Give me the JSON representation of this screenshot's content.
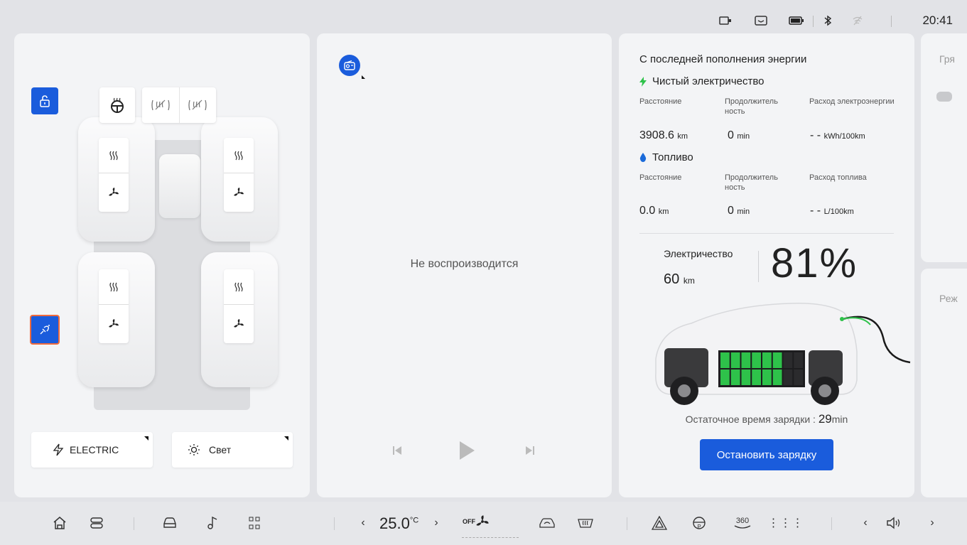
{
  "status": {
    "clock": "20:41",
    "icons": [
      "camera-icon",
      "message-icon",
      "battery-icon",
      "bluetooth-icon",
      "wifi-off-icon"
    ]
  },
  "climate_panel": {
    "steering_heat_icon": "steering-heat-icon",
    "windshield_icons": [
      "windshield-heat-icon",
      "windshield-heat-icon"
    ],
    "seats": [
      {
        "heat_icon": "seat-heat-icon",
        "fan_icon": "seat-fan-icon"
      },
      {
        "heat_icon": "seat-heat-icon",
        "fan_icon": "seat-fan-icon"
      },
      {
        "heat_icon": "seat-heat-icon",
        "fan_icon": "seat-fan-icon"
      },
      {
        "heat_icon": "seat-heat-icon",
        "fan_icon": "seat-fan-icon"
      }
    ],
    "mode_button": "ELECTRIC",
    "light_button": "Свет"
  },
  "media": {
    "status_text": "Не воспроизводится",
    "source_icon": "radio-icon"
  },
  "energy": {
    "header": "С последней пополнения энергии",
    "electric_title": "Чистый электричество",
    "electric_cols": [
      "Расстояние",
      "Продолжитель ность",
      "Расход электроэнергии"
    ],
    "electric_vals": [
      {
        "value": "3908.6",
        "unit": "km"
      },
      {
        "value": "0",
        "unit": "min"
      },
      {
        "value": "- -",
        "unit": "kWh/100km"
      }
    ],
    "fuel_title": "Топливо",
    "fuel_cols": [
      "Расстояние",
      "Продолжитель ность",
      "Расход топлива"
    ],
    "fuel_vals": [
      {
        "value": "0.0",
        "unit": "km"
      },
      {
        "value": "0",
        "unit": "min"
      },
      {
        "value": "- -",
        "unit": "L/100km"
      }
    ],
    "electricity_label": "Электричество",
    "range_value": "60",
    "range_unit": "km",
    "battery_percent": "81%",
    "battery_level": 0.81,
    "charge_time_label": "Остаточное время зарядки :",
    "charge_time_value": "29",
    "charge_time_unit": "min",
    "stop_button": "Остановить зарядку"
  },
  "right_cards": {
    "card1": "Гря",
    "card2": "Реж"
  },
  "dock": {
    "temperature": "25.0",
    "temp_unit": "°C",
    "fan_label": "OFF"
  },
  "colors": {
    "accent": "#1a5cdc",
    "green": "#2ec24a",
    "fuel": "#1a6ad9"
  }
}
